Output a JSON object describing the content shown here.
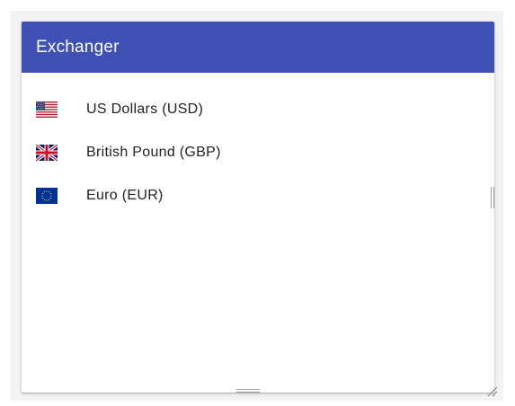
{
  "app": {
    "title": "Exchanger"
  },
  "currencies": [
    {
      "label": "US Dollars (USD)",
      "flag_icon": "us-flag-icon"
    },
    {
      "label": "British Pound (GBP)",
      "flag_icon": "uk-flag-icon"
    },
    {
      "label": "Euro (EUR)",
      "flag_icon": "eu-flag-icon"
    }
  ],
  "colors": {
    "app_bar": "#3f51b5",
    "text": "#212121"
  }
}
